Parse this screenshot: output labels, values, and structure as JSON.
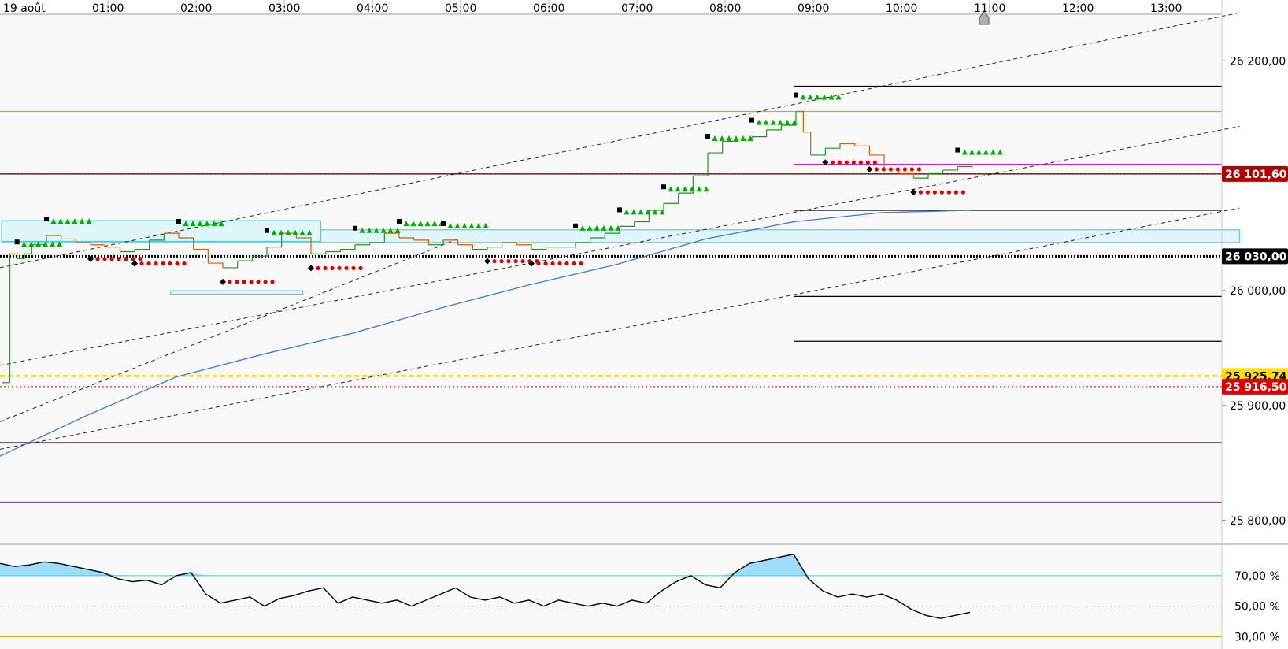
{
  "chart_data": [
    {
      "type": "line",
      "date_label": "19 août",
      "x_ticks": [
        "01:00",
        "02:00",
        "03:00",
        "04:00",
        "05:00",
        "06:00",
        "07:00",
        "08:00",
        "09:00",
        "10:00",
        "11:00",
        "12:00",
        "13:00"
      ],
      "y_ticks": [
        "26 200,00",
        "26 000,00",
        "25 900,00",
        "25 800,00"
      ],
      "ylim": [
        25780,
        26240
      ],
      "badges": [
        {
          "text": "26 101,60",
          "value": 26101.6,
          "bg": "#b00000",
          "fg": "#ffffff"
        },
        {
          "text": "26 030,00",
          "value": 26030.0,
          "bg": "#000000",
          "fg": "#ffffff"
        },
        {
          "text": "25 925,74",
          "value": 25925.74,
          "bg": "#ffe000",
          "fg": "#000000"
        },
        {
          "text": "25 916,50",
          "value": 25916.5,
          "bg": "#e00000",
          "fg": "#ffffff"
        }
      ],
      "hlines": [
        {
          "value": 26178,
          "from_time": "09:00",
          "color": "#000000"
        },
        {
          "value": 26156,
          "from_time": "00:00",
          "color": "#c8b400"
        },
        {
          "value": 26110,
          "from_time": "09:00",
          "color": "#ff00ff"
        },
        {
          "value": 26101.6,
          "from_time": "00:00",
          "color": "#000000"
        },
        {
          "value": 26070,
          "from_time": "09:00",
          "color": "#000000"
        },
        {
          "value": 25995,
          "from_time": "09:00",
          "color": "#000000"
        },
        {
          "value": 25956,
          "from_time": "09:00",
          "color": "#000000"
        },
        {
          "value": 25868,
          "from_time": "00:00",
          "color": "#ff00ff"
        },
        {
          "value": 25816,
          "from_time": "00:00",
          "color": "#ff00ff"
        }
      ],
      "price_series": {
        "time": [
          "00:00",
          "00:05",
          "00:10",
          "00:15",
          "00:20",
          "00:30",
          "00:40",
          "00:50",
          "01:00",
          "01:10",
          "01:20",
          "01:30",
          "01:40",
          "01:50",
          "02:00",
          "02:10",
          "02:20",
          "02:30",
          "02:40",
          "02:50",
          "03:00",
          "03:10",
          "03:20",
          "03:30",
          "03:40",
          "03:50",
          "04:00",
          "04:10",
          "04:20",
          "04:30",
          "04:40",
          "04:50",
          "05:00",
          "05:10",
          "05:20",
          "05:30",
          "05:40",
          "05:50",
          "06:00",
          "06:10",
          "06:20",
          "06:30",
          "06:40",
          "06:50",
          "07:00",
          "07:10",
          "07:20",
          "07:30",
          "07:40",
          "07:50",
          "08:00",
          "08:10",
          "08:20",
          "08:30",
          "08:40",
          "08:50",
          "09:00",
          "09:05",
          "09:10",
          "09:20",
          "09:30",
          "09:40",
          "09:50",
          "10:00",
          "10:10",
          "10:20",
          "10:30",
          "10:40",
          "10:50",
          "11:00"
        ],
        "close": [
          25920,
          26032,
          26028,
          26032,
          26040,
          26048,
          26045,
          26042,
          26040,
          26038,
          26034,
          26036,
          26044,
          26050,
          26046,
          26036,
          26024,
          26020,
          26026,
          26030,
          26038,
          26050,
          26046,
          26032,
          26034,
          26036,
          26040,
          26042,
          26050,
          26046,
          26044,
          26040,
          26044,
          26040,
          26036,
          26038,
          26042,
          26040,
          26036,
          26038,
          26038,
          26042,
          26046,
          26050,
          26056,
          26060,
          26070,
          26076,
          26085,
          26100,
          26120,
          26130,
          26132,
          26134,
          26140,
          26144,
          26156,
          26138,
          26118,
          26124,
          26128,
          26126,
          26118,
          26106,
          26102,
          26098,
          26102,
          26105,
          26108,
          26110
        ]
      },
      "ma_series": {
        "name": "",
        "color": "#3a7de0",
        "time": [
          "00:00",
          "01:00",
          "02:00",
          "03:00",
          "04:00",
          "05:00",
          "06:00",
          "07:00",
          "08:00",
          "09:00",
          "10:00",
          "11:00"
        ],
        "values": [
          25856,
          25892,
          25925,
          25945,
          25963,
          25985,
          26005,
          26023,
          26045,
          26060,
          26068,
          26070
        ]
      },
      "trendlines": [
        {
          "t1": "00:00",
          "v1": 26020,
          "t2": "13:50",
          "v2": 26242
        },
        {
          "t1": "00:00",
          "v1": 25935,
          "t2": "13:50",
          "v2": 26143
        },
        {
          "t1": "00:00",
          "v1": 25862,
          "t2": "13:50",
          "v2": 26072
        },
        {
          "t1": "00:00",
          "v1": 25886,
          "t2": "05:00",
          "v2": 26046
        }
      ],
      "zones": [
        {
          "from_time": "00:00",
          "to_time": "13:50",
          "top": 26053,
          "bottom": 26042
        },
        {
          "from_time": "00:00",
          "to_time": "03:25",
          "top": 26061,
          "bottom": 26043
        },
        {
          "from_time": "01:55",
          "to_time": "03:25",
          "top": 26000,
          "bottom": 25997
        }
      ]
    },
    {
      "type": "area",
      "y_ticks": [
        "70,00 %",
        "50,00 %",
        "30,00 %"
      ],
      "ylim": [
        22,
        90
      ],
      "upper_level": 70,
      "mid_level": 50,
      "lower_level": 30,
      "time": [
        "00:00",
        "00:10",
        "00:20",
        "00:30",
        "00:40",
        "00:50",
        "01:00",
        "01:10",
        "01:20",
        "01:30",
        "01:40",
        "01:50",
        "02:00",
        "02:10",
        "02:20",
        "02:30",
        "02:40",
        "02:50",
        "03:00",
        "03:10",
        "03:20",
        "03:30",
        "03:40",
        "03:50",
        "04:00",
        "04:10",
        "04:20",
        "04:30",
        "04:40",
        "04:50",
        "05:00",
        "05:10",
        "05:20",
        "05:30",
        "05:40",
        "05:50",
        "06:00",
        "06:10",
        "06:20",
        "06:30",
        "06:40",
        "06:50",
        "07:00",
        "07:10",
        "07:20",
        "07:30",
        "07:40",
        "07:50",
        "08:00",
        "08:10",
        "08:20",
        "08:30",
        "08:40",
        "08:50",
        "09:00",
        "09:10",
        "09:20",
        "09:30",
        "09:40",
        "09:50",
        "10:00",
        "10:10",
        "10:20",
        "10:30",
        "10:40",
        "10:50",
        "11:00"
      ],
      "values": [
        78,
        76,
        77,
        79,
        78,
        76,
        74,
        72,
        68,
        66,
        67,
        64,
        70,
        72,
        58,
        52,
        54,
        56,
        50,
        55,
        57,
        60,
        62,
        52,
        56,
        54,
        52,
        54,
        50,
        54,
        58,
        62,
        56,
        54,
        56,
        52,
        54,
        50,
        54,
        52,
        50,
        52,
        50,
        54,
        52,
        60,
        66,
        70,
        64,
        62,
        72,
        78,
        80,
        82,
        84,
        68,
        60,
        56,
        58,
        56,
        58,
        54,
        48,
        44,
        42,
        44,
        46
      ]
    }
  ],
  "colors": {
    "up": "#1a9a1a",
    "down": "#e05a00",
    "signal_up": "#00b000",
    "signal_down": "#e00000",
    "rsi_fill": "#9fdcf5",
    "zone_fill": "#dff6fb",
    "zone_stroke": "#3cc8dc"
  },
  "icons": [
    "home-icon"
  ]
}
